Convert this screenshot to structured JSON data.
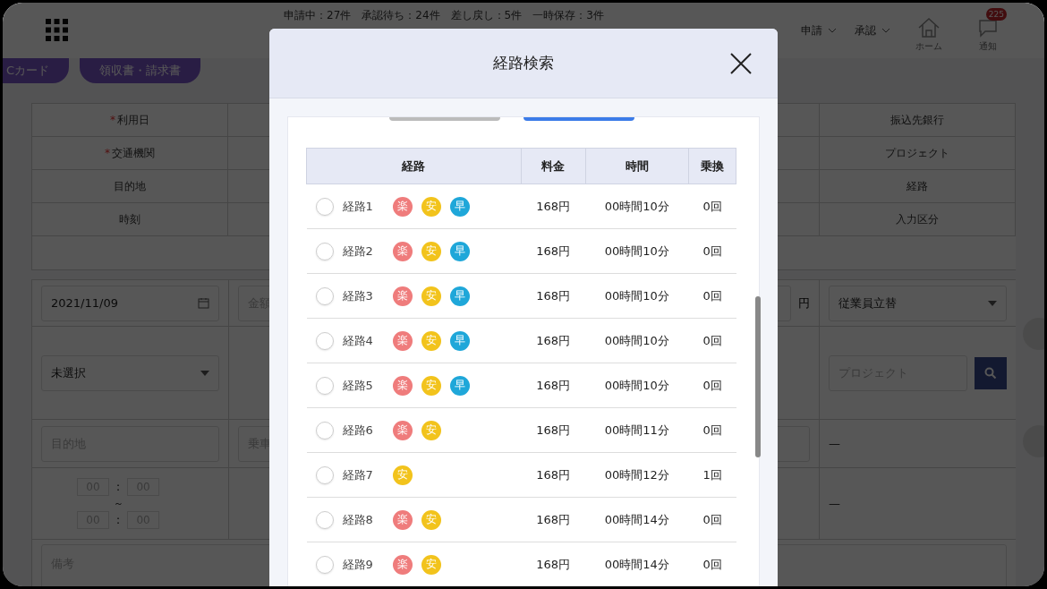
{
  "header": {
    "status_summary": "申請中：27件　承認待ち：24件　差し戻し：5件　一時保存：3件",
    "menus": [
      "申請",
      "承認"
    ],
    "home_label": "ホーム",
    "notice_label": "通知",
    "notice_badge": "225"
  },
  "action_buttons": [
    "Cカード",
    "領収書・請求書"
  ],
  "form_labels": [
    {
      "left": "利用日",
      "required_mark": "*",
      "right": "振込先銀行"
    },
    {
      "left": "交通機関",
      "required_mark": "*",
      "right": "プロジェクト"
    },
    {
      "left": "目的地",
      "right": "経路"
    },
    {
      "left": "時刻",
      "right": "入力区分"
    }
  ],
  "form": {
    "date": "2021/11/09",
    "amount_placeholder": "金額",
    "currency": "円",
    "payment_select": "従業員立替",
    "transport_select": "未選択",
    "project_placeholder": "プロジェクト",
    "destination_placeholder": "目的地",
    "boarding_placeholder": "乗車",
    "route_value": "—",
    "type_value": "—",
    "time_from": [
      "00",
      "00"
    ],
    "time_to": [
      "00",
      "00"
    ],
    "time_sep": ":",
    "tilde": "～",
    "notes_placeholder": "備考"
  },
  "modal": {
    "title": "経路検索",
    "columns": [
      "経路",
      "料金",
      "時間",
      "乗換"
    ],
    "routes": [
      {
        "name": "経路1",
        "tags": [
          {
            "label": "楽",
            "color": "#ef7c7c"
          },
          {
            "label": "安",
            "color": "#f2c31c"
          },
          {
            "label": "早",
            "color": "#1fa7d9"
          }
        ],
        "fare": "168円",
        "time": "00時間10分",
        "transfers": "0回",
        "selected": false
      },
      {
        "name": "経路2",
        "tags": [
          {
            "label": "楽",
            "color": "#ef7c7c"
          },
          {
            "label": "安",
            "color": "#f2c31c"
          },
          {
            "label": "早",
            "color": "#1fa7d9"
          }
        ],
        "fare": "168円",
        "time": "00時間10分",
        "transfers": "0回",
        "selected": false
      },
      {
        "name": "経路3",
        "tags": [
          {
            "label": "楽",
            "color": "#ef7c7c"
          },
          {
            "label": "安",
            "color": "#f2c31c"
          },
          {
            "label": "早",
            "color": "#1fa7d9"
          }
        ],
        "fare": "168円",
        "time": "00時間10分",
        "transfers": "0回",
        "selected": false
      },
      {
        "name": "経路4",
        "tags": [
          {
            "label": "楽",
            "color": "#ef7c7c"
          },
          {
            "label": "安",
            "color": "#f2c31c"
          },
          {
            "label": "早",
            "color": "#1fa7d9"
          }
        ],
        "fare": "168円",
        "time": "00時間10分",
        "transfers": "0回",
        "selected": false
      },
      {
        "name": "経路5",
        "tags": [
          {
            "label": "楽",
            "color": "#ef7c7c"
          },
          {
            "label": "安",
            "color": "#f2c31c"
          },
          {
            "label": "早",
            "color": "#1fa7d9"
          }
        ],
        "fare": "168円",
        "time": "00時間10分",
        "transfers": "0回",
        "selected": false
      },
      {
        "name": "経路6",
        "tags": [
          {
            "label": "楽",
            "color": "#ef7c7c"
          },
          {
            "label": "安",
            "color": "#f2c31c"
          }
        ],
        "fare": "168円",
        "time": "00時間11分",
        "transfers": "0回",
        "selected": false
      },
      {
        "name": "経路7",
        "tags": [
          {
            "label": "安",
            "color": "#f2c31c"
          }
        ],
        "fare": "168円",
        "time": "00時間12分",
        "transfers": "1回",
        "selected": false
      },
      {
        "name": "経路8",
        "tags": [
          {
            "label": "楽",
            "color": "#ef7c7c"
          },
          {
            "label": "安",
            "color": "#f2c31c"
          }
        ],
        "fare": "168円",
        "time": "00時間14分",
        "transfers": "0回",
        "selected": false
      },
      {
        "name": "経路9",
        "tags": [
          {
            "label": "楽",
            "color": "#ef7c7c"
          },
          {
            "label": "安",
            "color": "#f2c31c"
          }
        ],
        "fare": "168円",
        "time": "00時間14分",
        "transfers": "0回",
        "selected": false
      }
    ]
  }
}
